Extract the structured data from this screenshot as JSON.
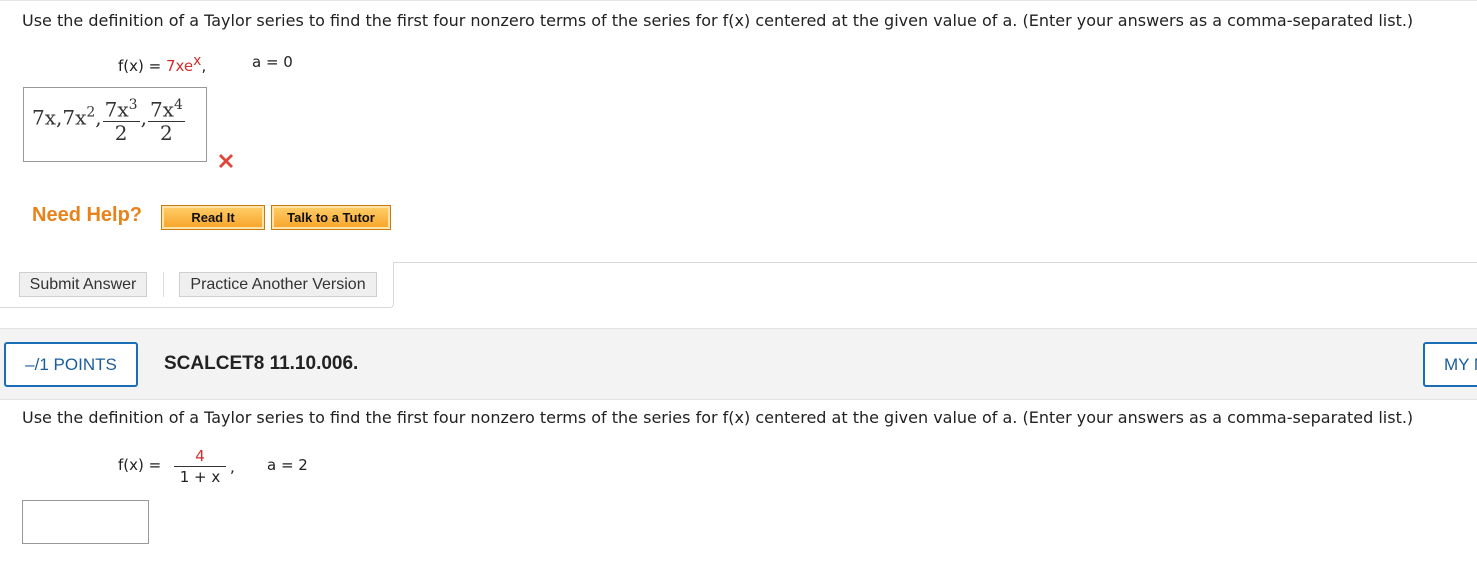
{
  "question1": {
    "prompt": "Use the definition of a Taylor series to find the first four nonzero terms of the series for f(x) centered at the given value of a. (Enter your answers as a comma-separated list.)",
    "function_label": "f(x) = ",
    "function_value": "7xe",
    "function_exp": "x",
    "function_suffix": ",",
    "a_label": "a = 0",
    "answer": {
      "t1": "7x,7x",
      "t1_exp": "2",
      "sep": ",",
      "f1_num": "7x",
      "f1_num_exp": "3",
      "f1_den": "2",
      "f2_num": "7x",
      "f2_num_exp": "4",
      "f2_den": "2"
    },
    "status_icon": "x-mark-icon",
    "status_color": "#e0453a"
  },
  "help": {
    "label": "Need Help?",
    "read_it": "Read It",
    "talk_tutor": "Talk to a Tutor"
  },
  "actions": {
    "submit": "Submit Answer",
    "practice": "Practice Another Version"
  },
  "question2_header": {
    "points": "–/1 POINTS",
    "id": "SCALCET8 11.10.006.",
    "my_notes": "MY NOTES"
  },
  "question2": {
    "prompt": "Use the definition of a Taylor series to find the first four nonzero terms of the series for f(x) centered at the given value of a. (Enter your answers as a comma-separated list.)",
    "function_label": "f(x) = ",
    "frac_num": "4",
    "frac_den": "1 + x",
    "comma": ",",
    "a_label": "a = 2",
    "answer_value": ""
  },
  "colors": {
    "accent_blue": "#1a6eb5",
    "help_orange": "#e8821a",
    "value_red": "#d12f2f"
  }
}
